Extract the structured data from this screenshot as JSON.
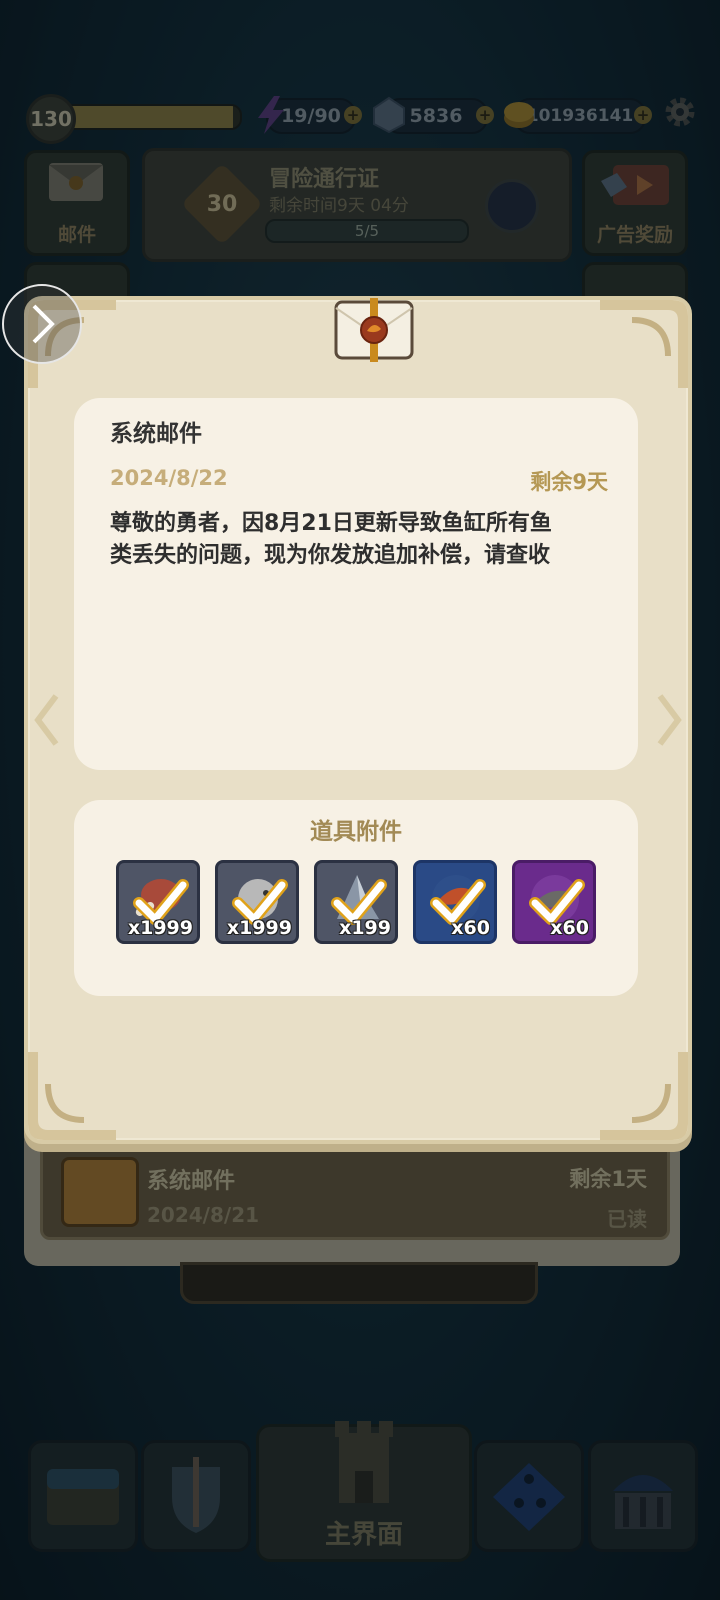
{
  "top_bar": {
    "level": "130",
    "xp_fraction": 0.96,
    "energy": "19/90",
    "gems": "5836",
    "coins": "101936141",
    "plus_symbol": "+"
  },
  "header": {
    "mail_label": "邮件",
    "ad_reward_label": "广告奖励",
    "pass": {
      "badge_level": "30",
      "title": "冒险通行证",
      "time_remaining": "剩余时间9天 04分",
      "progress": "5/5"
    }
  },
  "modal": {
    "sender": "系统邮件",
    "date": "2024/8/22",
    "remaining": "剩余9天",
    "body_lines": [
      "尊敬的勇者，因8月21日更新导致鱼缸所有鱼",
      "类丢失的问题，现为你发放追加补偿，请查收"
    ],
    "attachments": {
      "title": "道具附件",
      "items": [
        {
          "name": "fish-item-1",
          "qty": "x1999",
          "rarity": "gray",
          "icon": "meat-icon"
        },
        {
          "name": "fish-item-2",
          "qty": "x1999",
          "rarity": "gray",
          "icon": "round-fish-icon"
        },
        {
          "name": "fish-item-3",
          "qty": "x199",
          "rarity": "gray",
          "icon": "fin-icon"
        },
        {
          "name": "fish-item-4",
          "qty": "x60",
          "rarity": "blue",
          "icon": "red-fish-icon"
        },
        {
          "name": "fish-item-5",
          "qty": "x60",
          "rarity": "purple",
          "icon": "gray-fish-icon"
        }
      ]
    }
  },
  "mail_list": {
    "item": {
      "title": "系统邮件",
      "remaining": "剩余1天",
      "date": "2024/8/21",
      "status": "已读"
    }
  },
  "nav": {
    "main_label": "主界面"
  },
  "colors": {
    "parchment": "#e8dfc7",
    "paper": "#f7f1e5",
    "gold_text": "#b59854",
    "check_white": "#ffffff",
    "check_gold": "#e0a21a"
  }
}
